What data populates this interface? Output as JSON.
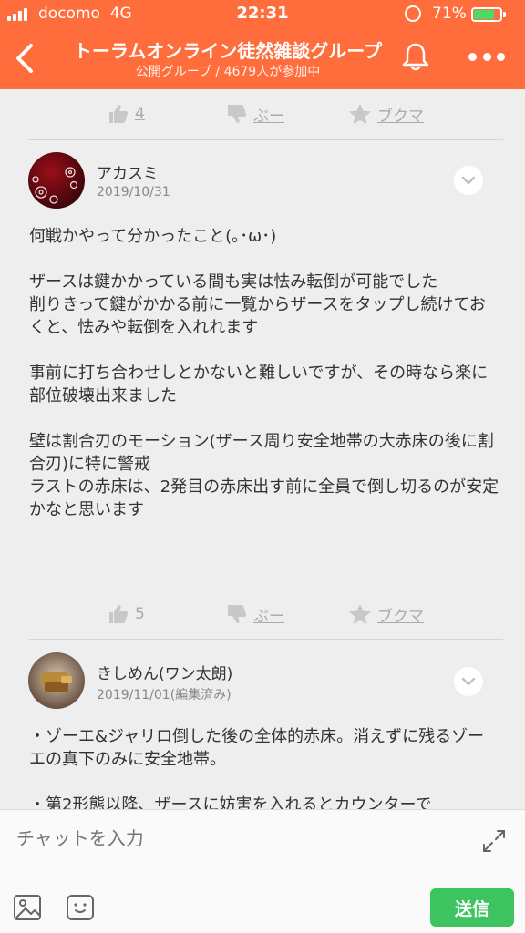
{
  "status": {
    "carrier": "docomo",
    "network": "4G",
    "time": "22:31",
    "battery": "71%"
  },
  "header": {
    "title": "トーラムオンライン徒然雑談グループ",
    "subtitle": "公開グループ / 4679人が参加中"
  },
  "reactions_top": {
    "likes": "4",
    "dislike": "ぶー",
    "bookmark": "ブクマ"
  },
  "post1": {
    "author": "アカスミ",
    "date": "2019/10/31",
    "body": "何戦かやって分かったこと(｡･ω･)\n\nザースは鍵かかっている間も実は怯み転倒が可能でした\n削りきって鍵がかかる前に一覧からザースをタップし続けておくと、怯みや転倒を入れれます\n\n事前に打ち合わせしとかないと難しいですが、その時なら楽に部位破壊出来ました\n\n壁は割合刃のモーション(ザース周り安全地帯の大赤床の後に割合刃)に特に警戒\nラストの赤床は、2発目の赤床出す前に全員で倒し切るのが安定かなと思います",
    "likes": "5",
    "dislike": "ぶー",
    "bookmark": "ブクマ"
  },
  "post2": {
    "author": "きしめん(ワン太朗)",
    "date": "2019/11/01(編集済み)",
    "body": "・ゾーエ&ジャリロ倒した後の全体的赤床。消えずに残るゾーエの真下のみに安全地帯。\n\n・第2形態以降、ザースに妨害を入れるとカウンターで"
  },
  "composer": {
    "placeholder": "チャットを入力",
    "send_label": "送信"
  },
  "colors": {
    "accent": "#ff6d3d",
    "send": "#3dc461"
  }
}
